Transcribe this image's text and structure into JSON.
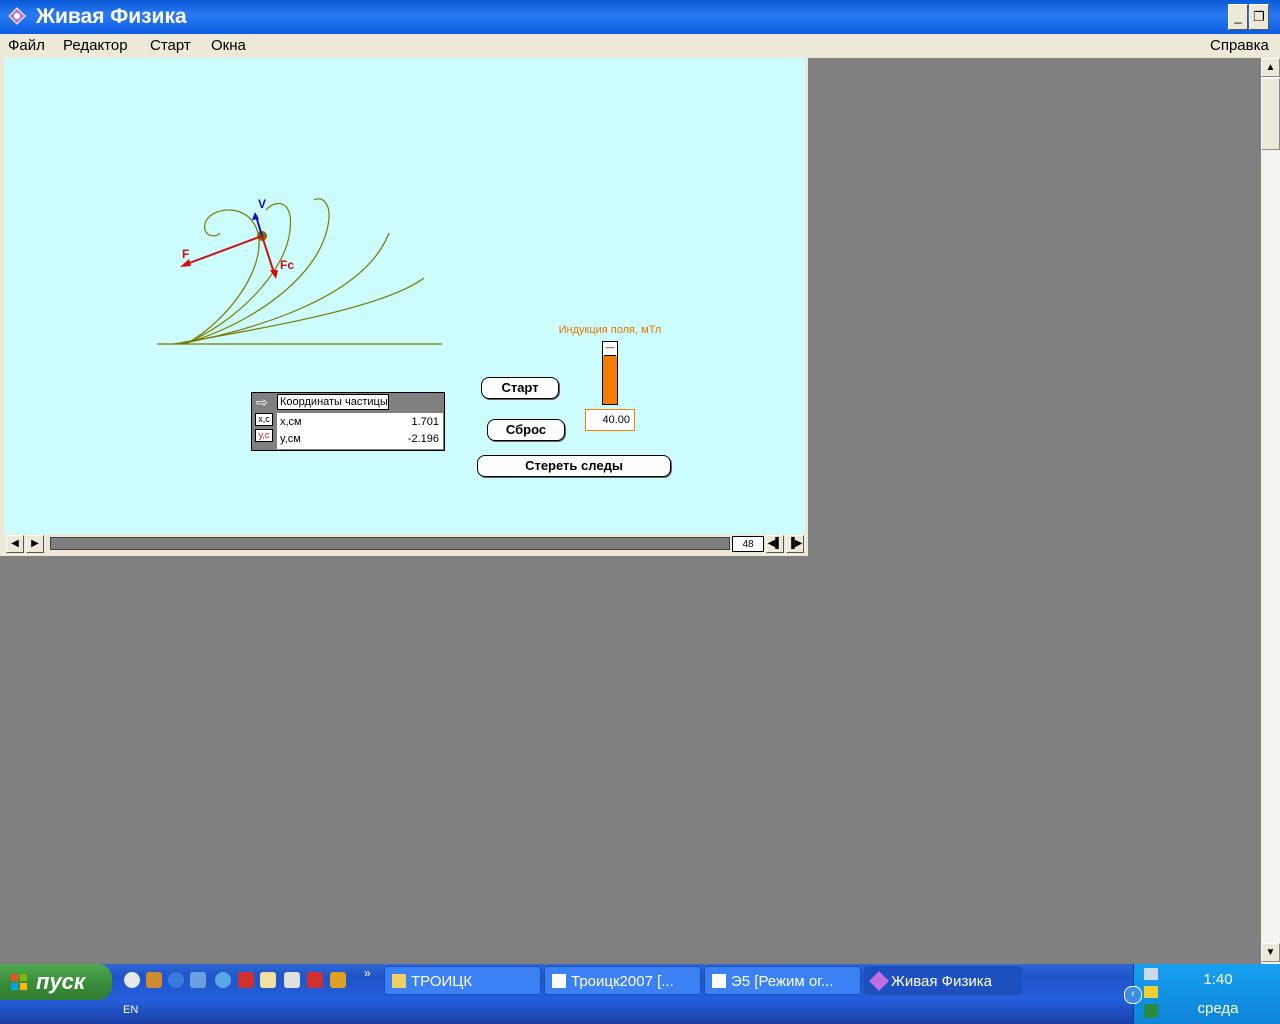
{
  "window": {
    "title": "Живая Физика",
    "icon": "zhivaya-fizika-icon"
  },
  "menu": {
    "file": "Файл",
    "edit": "Редактор",
    "start": "Старт",
    "windows": "Окна",
    "help": "Справка"
  },
  "scene": {
    "vectors": {
      "v": "V",
      "f": "F",
      "fc": "Fc"
    },
    "colors": {
      "trajectory": "#7a7a00",
      "force": "#d01010",
      "velocity": "#1010c0",
      "particle": "#8a6a00"
    }
  },
  "coords": {
    "title": "Координаты частицы",
    "tag_x": "x,c",
    "tag_y": "y,c",
    "rows": [
      {
        "name": "x,см",
        "value": "1.701"
      },
      {
        "name": "y,см",
        "value": "-2.196"
      }
    ]
  },
  "buttons": {
    "start": "Старт",
    "reset": "Сброс",
    "clear": "Стереть следы"
  },
  "slider": {
    "label": "Индукция поля, мТл",
    "value": "40.00",
    "fill_fraction": 0.78,
    "color": "#f57d00"
  },
  "timeline": {
    "frame": "48"
  },
  "taskbar": {
    "start": "пуск",
    "lang": "EN",
    "tasks": [
      {
        "label": "ТРОИЦК",
        "icon": "folder-icon"
      },
      {
        "label": "Троицк2007 [...",
        "icon": "document-icon"
      },
      {
        "label": "Э5 [Режим ог...",
        "icon": "document-icon"
      },
      {
        "label": "Живая Физика",
        "icon": "zhivaya-fizika-icon"
      }
    ],
    "time": "1:40",
    "day": "среда"
  }
}
